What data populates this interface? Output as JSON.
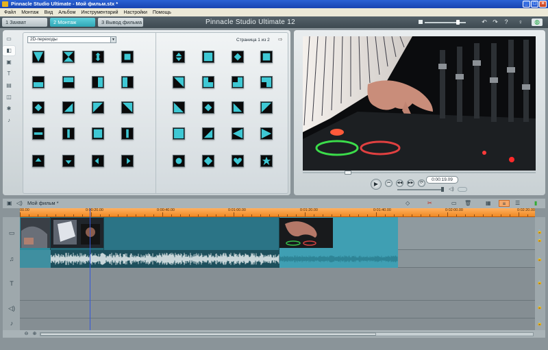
{
  "window": {
    "title": "Pinnacle Studio Ultimate - Мой фильм.stx *",
    "buttons": {
      "minimize": "_",
      "maximize": "□",
      "close": "×"
    }
  },
  "menu": [
    "Файл",
    "Монтаж",
    "Вид",
    "Альбом",
    "Инструментарий",
    "Настройки",
    "Помощь"
  ],
  "modes": [
    {
      "label": "1 Захват",
      "active": false
    },
    {
      "label": "2 Монтаж",
      "active": true
    },
    {
      "label": "3 Вывод фильма",
      "active": false
    }
  ],
  "brand": "Pinnacle Studio Ultimate 12",
  "top_icons": [
    "undo-icon",
    "redo-icon",
    "help-icon",
    "hint-icon",
    "globe-icon"
  ],
  "album": {
    "category": "2D-переходы",
    "page": "Страница 1 из 2",
    "tabs": [
      "video-tab-icon",
      "transitions-tab-icon",
      "photos-tab-icon",
      "titles-tab-icon",
      "menus-tab-icon",
      "effects-tab-icon",
      "sound-effects-tab-icon",
      "music-tab-icon"
    ],
    "active_tab": 1
  },
  "preview": {
    "timecode": "0:00:19.09",
    "scrub_position": 0.18,
    "volume": 0.97
  },
  "timeline": {
    "project_name": "Мой фильм *",
    "ruler_labels": [
      "00.00",
      "0:00:20.00",
      "0:00:40.00",
      "0:01:00.00",
      "0:01:20.00",
      "0:01:40.00",
      "0:02:00.00",
      "0:02:20.00"
    ],
    "playhead_time": "0:00:19.09"
  },
  "colors": {
    "accent": "#2fa7b6",
    "ruler": "#f08a25",
    "clip_video": "#2e8ea2",
    "clip_audio": "#3f9fb3",
    "playhead": "#3558d8"
  }
}
